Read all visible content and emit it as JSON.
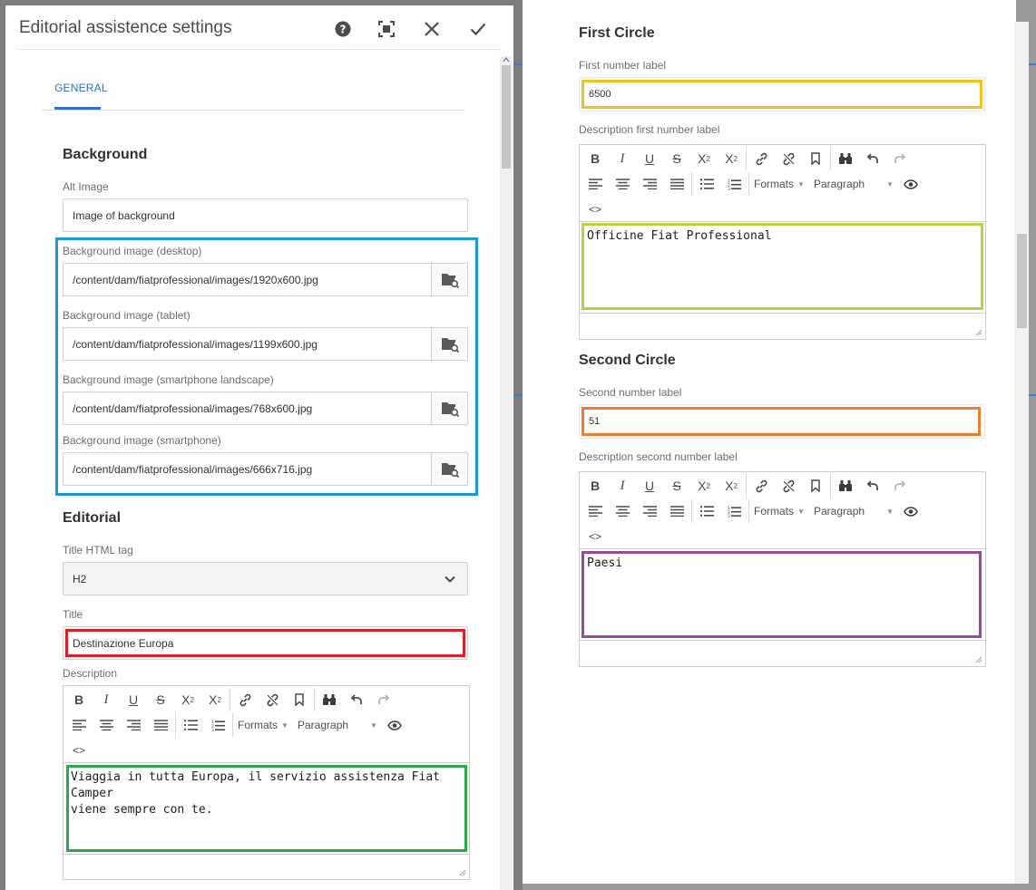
{
  "dialog": {
    "title": "Editorial assistence settings",
    "tabs": [
      {
        "label": "GENERAL",
        "active": true
      }
    ]
  },
  "background": {
    "heading": "Background",
    "alt_label": "Alt Image",
    "alt_value": "Image of background",
    "images": [
      {
        "label": "Background image (desktop)",
        "value": "/content/dam/fiatprofessional/images/1920x600.jpg"
      },
      {
        "label": "Background image (tablet)",
        "value": "/content/dam/fiatprofessional/images/1199x600.jpg"
      },
      {
        "label": "Background image (smartphone landscape)",
        "value": "/content/dam/fiatprofessional/images/768x600.jpg"
      },
      {
        "label": "Background image (smartphone)",
        "value": "/content/dam/fiatprofessional/images/666x716.jpg"
      }
    ]
  },
  "editorial": {
    "heading": "Editorial",
    "tag_label": "Title HTML tag",
    "tag_value": "H2",
    "title_label": "Title",
    "title_value": "Destinazione Europa",
    "description_label": "Description",
    "description_text": "Viaggia in tutta Europa, il servizio assistenza Fiat Camper\nviene sempre con te."
  },
  "rte_toolbar": {
    "formats": "Formats",
    "paragraph": "Paragraph",
    "source": "<>"
  },
  "first_circle": {
    "heading": "First Circle",
    "number_label": "First number label",
    "number_value": "6500",
    "desc_label": "Description first number label",
    "desc_text": "Officine Fiat Professional"
  },
  "second_circle": {
    "heading": "Second Circle",
    "number_label": "Second number label",
    "number_value": "51",
    "desc_label": "Description second number label",
    "desc_text": "Paesi"
  },
  "colors": {
    "accent": "#326ec8",
    "highlight_blue": "#1a9ad6",
    "highlight_red": "#d9202a",
    "highlight_green": "#2aa84a",
    "highlight_yellow": "#f0c419",
    "highlight_lime": "#b4d43c",
    "highlight_orange": "#ee7d2d",
    "highlight_purple": "#9b4a9b"
  },
  "icons": [
    "help-icon",
    "fullscreen-icon",
    "close-icon",
    "done-icon",
    "folder-search-icon",
    "chevron-down-icon"
  ]
}
